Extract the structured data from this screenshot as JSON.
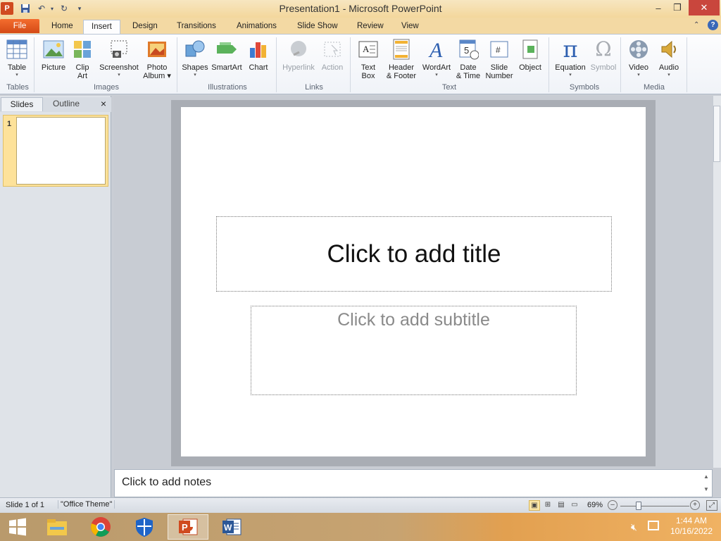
{
  "window": {
    "title": "Presentation1  -  Microsoft PowerPoint"
  },
  "quick_access": {
    "app_icon": "powerpoint-logo-icon",
    "save": "save-icon",
    "undo": "undo-icon",
    "redo": "redo-icon",
    "customize": "customize-dropdown-icon"
  },
  "tabs": {
    "file": "File",
    "home": "Home",
    "insert": "Insert",
    "design": "Design",
    "transitions": "Transitions",
    "animations": "Animations",
    "slideshow": "Slide Show",
    "review": "Review",
    "view": "View"
  },
  "ribbon": {
    "table": {
      "label": "Table",
      "icon": "table-icon"
    },
    "picture": {
      "label": "Picture",
      "icon": "picture-icon"
    },
    "clipart": {
      "label1": "Clip",
      "label2": "Art",
      "icon": "clip-art-icon"
    },
    "screenshot": {
      "label": "Screenshot",
      "icon": "screenshot-icon"
    },
    "photoalbum": {
      "label1": "Photo",
      "label2": "Album",
      "icon": "photo-album-icon"
    },
    "shapes": {
      "label": "Shapes",
      "icon": "shapes-icon"
    },
    "smartart": {
      "label": "SmartArt",
      "icon": "smartart-icon"
    },
    "chart": {
      "label": "Chart",
      "icon": "chart-icon"
    },
    "hyperlink": {
      "label": "Hyperlink",
      "icon": "hyperlink-icon"
    },
    "action": {
      "label": "Action",
      "icon": "action-icon"
    },
    "textbox": {
      "label1": "Text",
      "label2": "Box",
      "icon": "text-box-icon"
    },
    "headerfooter": {
      "label1": "Header",
      "label2": "& Footer",
      "icon": "header-footer-icon"
    },
    "wordart": {
      "label": "WordArt",
      "icon": "wordart-icon"
    },
    "datetime": {
      "label1": "Date",
      "label2": "& Time",
      "icon": "date-time-icon"
    },
    "slidenumber": {
      "label1": "Slide",
      "label2": "Number",
      "icon": "slide-number-icon"
    },
    "object": {
      "label": "Object",
      "icon": "object-icon"
    },
    "equation": {
      "label": "Equation",
      "icon": "equation-icon"
    },
    "symbol": {
      "label": "Symbol",
      "icon": "symbol-icon"
    },
    "video": {
      "label": "Video",
      "icon": "video-icon"
    },
    "audio": {
      "label": "Audio",
      "icon": "audio-icon"
    },
    "groups": {
      "tables": "Tables",
      "images": "Images",
      "illustrations": "Illustrations",
      "links": "Links",
      "text": "Text",
      "symbols": "Symbols",
      "media": "Media"
    }
  },
  "slide_pane": {
    "tab_slides": "Slides",
    "tab_outline": "Outline",
    "close": "×",
    "slide_number": "1"
  },
  "slide": {
    "title_placeholder": "Click to add title",
    "subtitle_placeholder": "Click to add subtitle"
  },
  "notes": {
    "placeholder": "Click to add notes"
  },
  "status": {
    "slide_info": "Slide 1 of 1",
    "theme": "\"Office Theme\"",
    "zoom": "69%",
    "zoom_fraction": 0.27
  },
  "taskbar": {
    "apps": [
      "windows-start-icon",
      "file-explorer-icon",
      "chrome-icon",
      "windows-defender-icon",
      "powerpoint-icon",
      "word-icon"
    ],
    "time": "1:44 AM",
    "date": "10/16/2022"
  },
  "colors": {
    "file_tab": "#d44a16",
    "title_bar": "#f3d79c",
    "ribbon": "#f0f3f8"
  }
}
